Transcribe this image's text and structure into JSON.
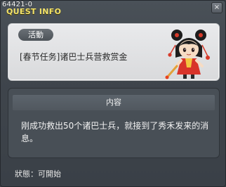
{
  "window": {
    "quest_id": "64421-0",
    "title": "QUEST INFO",
    "close_glyph": "×"
  },
  "quest": {
    "category": "活動",
    "name": "[春节任务]诸巴士兵营救赏金",
    "npc_icon": "npc-portrait"
  },
  "content": {
    "header": "内容",
    "text": "刚成功救出50个诸巴士兵，就接到了秀禾发来的消息。"
  },
  "status": {
    "text": "狀態：可開始"
  },
  "colors": {
    "title": "#f3e36a",
    "panel_light": "#e4e5e7",
    "panel_dark": "#484f56"
  }
}
